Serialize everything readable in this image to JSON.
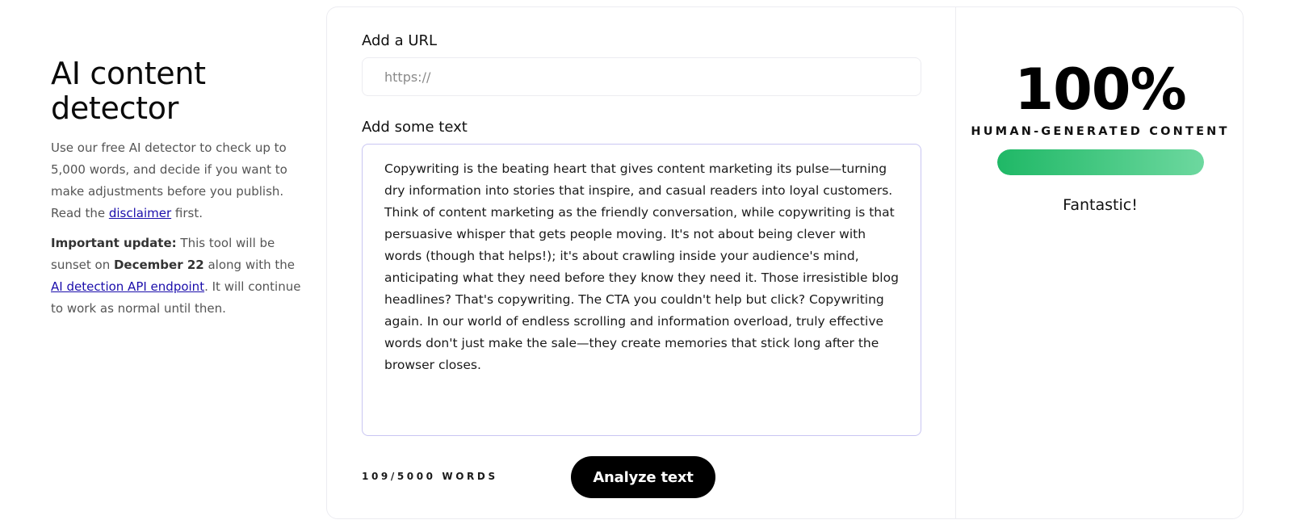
{
  "intro": {
    "title": "AI content detector",
    "desc_pre": "Use our free AI detector to check up to 5,000 words, and decide if you want to make adjustments before you publish. Read the ",
    "disclaimer_link": "disclaimer",
    "desc_post": " first.",
    "update_label": "Important update:",
    "update_pre": " This tool will be sunset on ",
    "update_date": "December 22",
    "update_mid": " along with the ",
    "api_link": "AI detection API endpoint",
    "update_post": ". It will continue to work as normal until then."
  },
  "editor": {
    "url_label": "Add a URL",
    "url_placeholder": "https://",
    "url_value": "",
    "text_label": "Add some text",
    "text_value": "Copywriting is the beating heart that gives content marketing its pulse—turning dry information into stories that inspire, and casual readers into loyal customers. Think of content marketing as the friendly conversation, while copywriting is that persuasive whisper that gets people moving. It's not about being clever with words (though that helps!); it's about crawling inside your audience's mind, anticipating what they need before they know they need it. Those irresistible blog headlines? That's copywriting. The CTA you couldn't help but click? Copywriting again. In our world of endless scrolling and information overload, truly effective words don't just make the sale—they create memories that stick long after the browser closes.",
    "word_count": "109/5000 WORDS",
    "analyze_label": "Analyze text"
  },
  "result": {
    "score": "100%",
    "score_label": "HUMAN-GENERATED CONTENT",
    "progress_percent": 100,
    "verdict": "Fantastic!"
  },
  "colors": {
    "accent_green": "#1fb866",
    "button_bg": "#000000",
    "link": "#1a0dab"
  }
}
